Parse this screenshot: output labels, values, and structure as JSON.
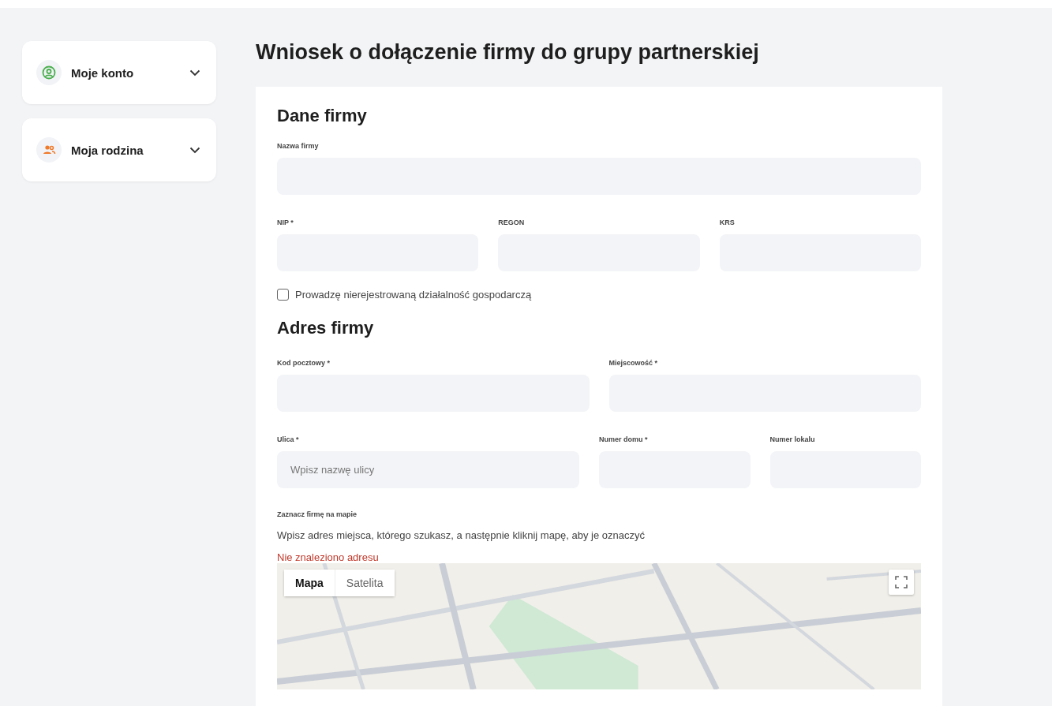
{
  "sidebar": {
    "items": [
      {
        "label": "Moje konto",
        "kind": "account",
        "expanded": false
      },
      {
        "label": "Moja rodzina",
        "kind": "family",
        "expanded": false
      }
    ]
  },
  "page_title": "Wniosek o dołączenie firmy do grupy partnerskiej",
  "company": {
    "heading": "Dane firmy",
    "rows": [
      [
        {
          "label": "Nazwa firmy"
        }
      ],
      [
        {
          "label": "NIP *"
        },
        {
          "label": "REGON"
        },
        {
          "label": "KRS"
        }
      ]
    ],
    "checkbox": {
      "label": "Prowadzę nierejestrowaną działalność gospodarczą",
      "checked": false
    }
  },
  "address": {
    "heading": "Adres firmy",
    "rows": [
      [
        {
          "label": "Kod pocztowy *"
        },
        {
          "label": "Miejscowość *"
        }
      ],
      [
        {
          "label": "Ulica *",
          "placeholder": "Wpisz nazwę ulicy"
        },
        {
          "label": "Numer domu *"
        },
        {
          "label": "Numer lokalu"
        }
      ]
    ]
  },
  "map": {
    "label": "Zaznacz firmę na mapie",
    "hint": "Wpisz adres miejsca, którego szukasz, a następnie kliknij mapę, aby je oznaczyć",
    "error": "Nie znaleziono adresu",
    "tabs": [
      {
        "label": "Mapa",
        "selected": true
      },
      {
        "label": "Satelita",
        "selected": false
      }
    ]
  }
}
